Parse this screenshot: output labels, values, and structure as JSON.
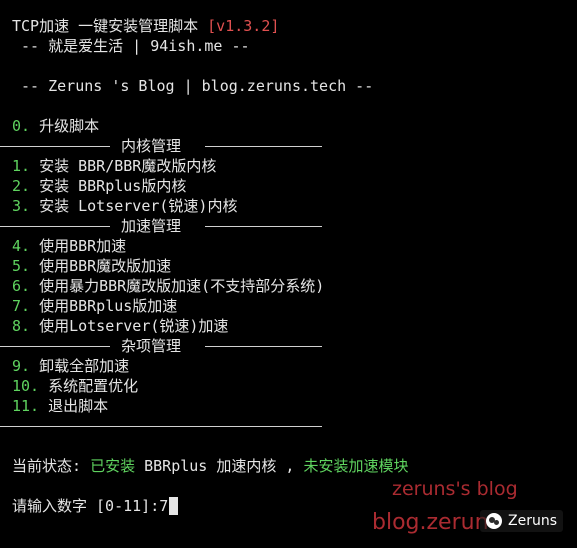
{
  "header": {
    "title": "TCP加速 一键安装管理脚本 ",
    "version": "[v1.3.2]",
    "subtitle": " -- 就是爱生活 | 94ish.me --",
    "blog_line": " -- Zeruns 's Blog | blog.zeruns.tech --"
  },
  "menu": {
    "upgrade": {
      "num": "0.",
      "label": " 升级脚本"
    },
    "section_kernel": "内核管理",
    "kernel_items": [
      {
        "num": "1.",
        "label": " 安装 BBR/BBR魔改版内核"
      },
      {
        "num": "2.",
        "label": " 安装 BBRplus版内核"
      },
      {
        "num": "3.",
        "label": " 安装 Lotserver(锐速)内核"
      }
    ],
    "section_accel": "加速管理",
    "accel_items": [
      {
        "num": "4.",
        "label": " 使用BBR加速"
      },
      {
        "num": "5.",
        "label": " 使用BBR魔改版加速"
      },
      {
        "num": "6.",
        "label": " 使用暴力BBR魔改版加速(不支持部分系统)"
      },
      {
        "num": "7.",
        "label": " 使用BBRplus版加速"
      },
      {
        "num": "8.",
        "label": " 使用Lotserver(锐速)加速"
      }
    ],
    "section_misc": "杂项管理",
    "misc_items": [
      {
        "num": "9.",
        "label": " 卸载全部加速"
      },
      {
        "num": "10.",
        "label": " 系统配置优化"
      },
      {
        "num": "11.",
        "label": " 退出脚本"
      }
    ]
  },
  "status": {
    "prefix": "当前状态: ",
    "installed": "已安装",
    "kernel": " BBRplus 加速内核 , ",
    "module": "未安装加速模块"
  },
  "prompt": {
    "text": "请输入数字 [0-11]:",
    "value": "7"
  },
  "watermark": {
    "line1": "zeruns's blog",
    "line2": "blog.zerun",
    "badge": "Zeruns"
  },
  "colors": {
    "background": "#000000",
    "text": "#e5e5e5",
    "number_green": "#5fd35f",
    "version_red": "#e05050"
  }
}
